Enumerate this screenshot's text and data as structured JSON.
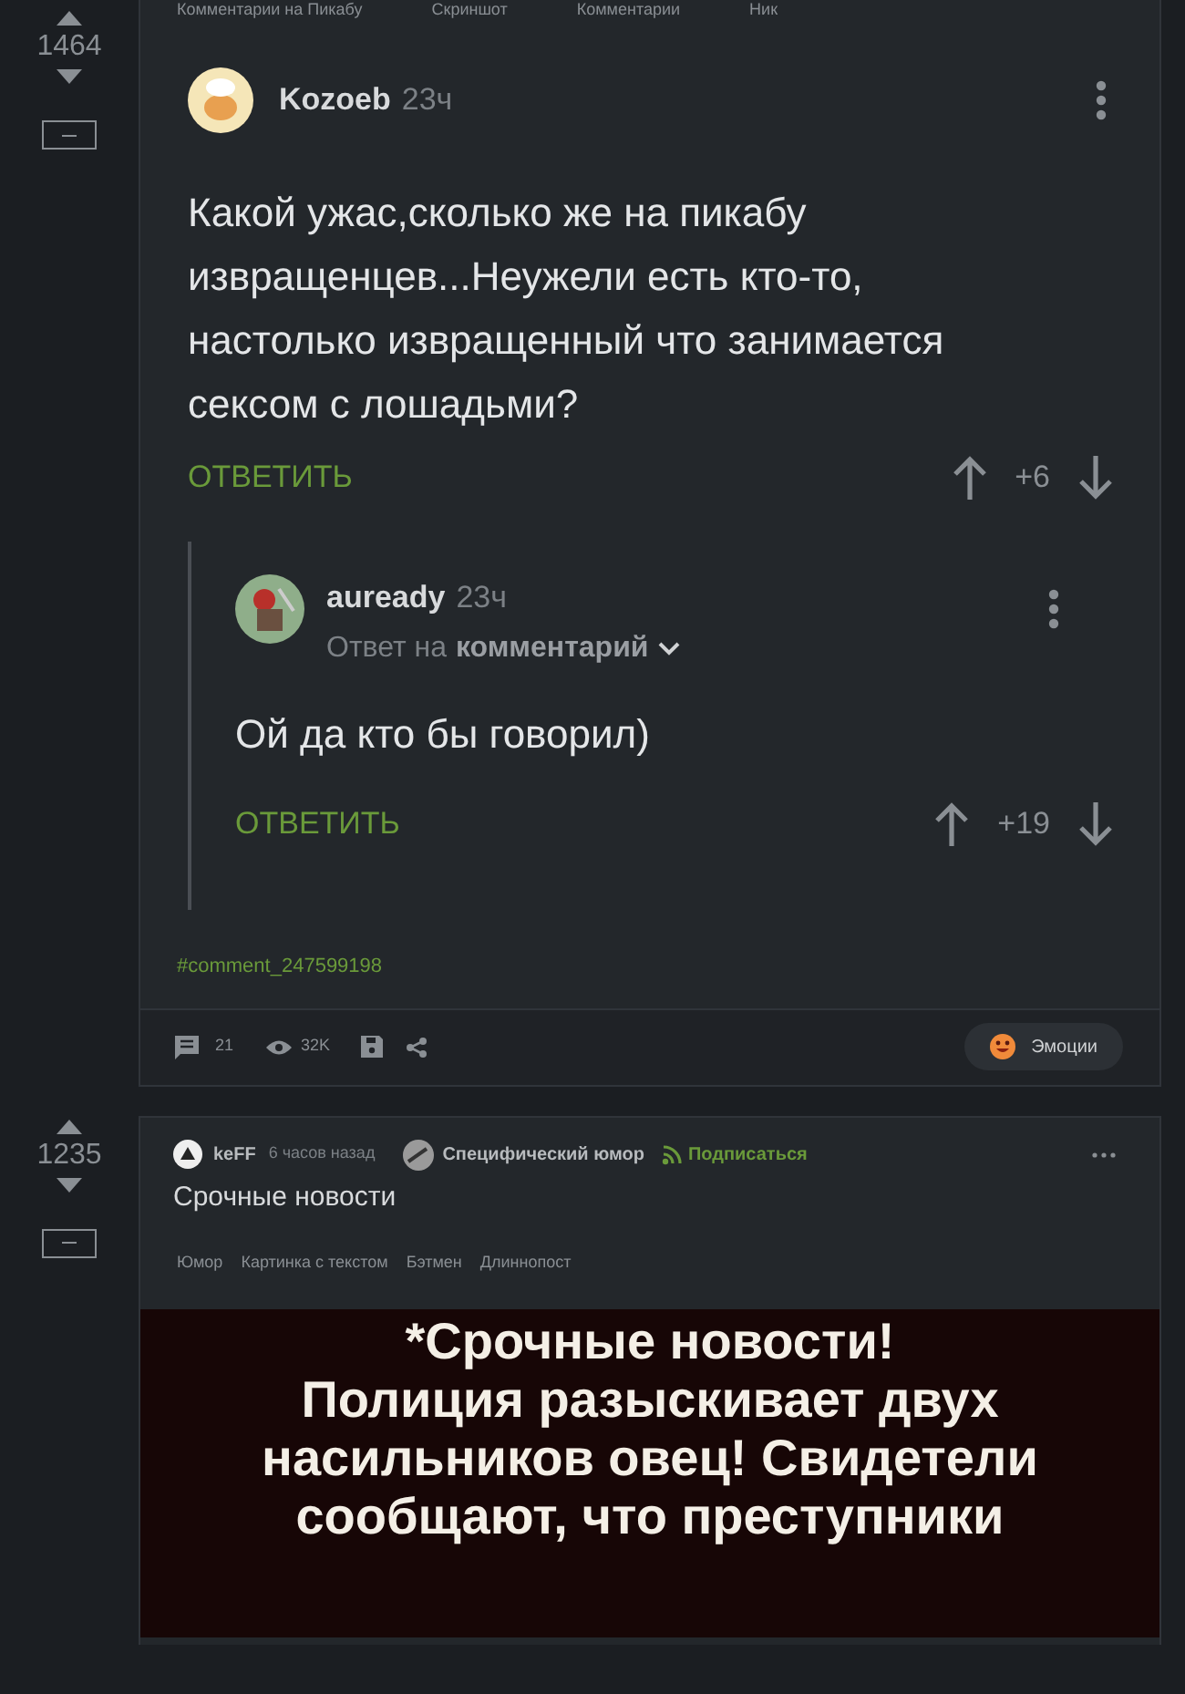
{
  "top_tags": [
    "Комментарии на Пикабу",
    "Скриншот",
    "Комментарии",
    "Ник"
  ],
  "post1": {
    "rating": "1464",
    "comment": {
      "author": "Kozoeb",
      "time": "23ч",
      "text": "Какой ужас,сколько же на пикабу извращенцев...Неужели есть кто-то, настолько извращенный что занимается сексом с лошадьми?",
      "reply_label": "ОТВЕТИТЬ",
      "score": "+6",
      "reply": {
        "author": "auready",
        "time": "23ч",
        "reply_to_prefix": "Ответ на",
        "reply_to_link": "комментарий",
        "text": "Ой да кто бы говорил)",
        "reply_label": "ОТВЕТИТЬ",
        "score": "+19"
      }
    },
    "anchor": "#comment_247599198",
    "footer": {
      "comments": "21",
      "views": "32K",
      "emotions_label": "Эмоции"
    }
  },
  "post2": {
    "rating": "1235",
    "author": "keFF",
    "time": "6 часов назад",
    "community": "Специфический юмор",
    "subscribe_label": "Подписаться",
    "title": "Срочные новости",
    "tags": [
      "Юмор",
      "Картинка с текстом",
      "Бэтмен",
      "Длиннопост"
    ],
    "image_lines": [
      "*Срочные новости!",
      "Полиция разыскивает двух",
      "насильников овец! Свидетели",
      "сообщают, что преступники"
    ]
  }
}
